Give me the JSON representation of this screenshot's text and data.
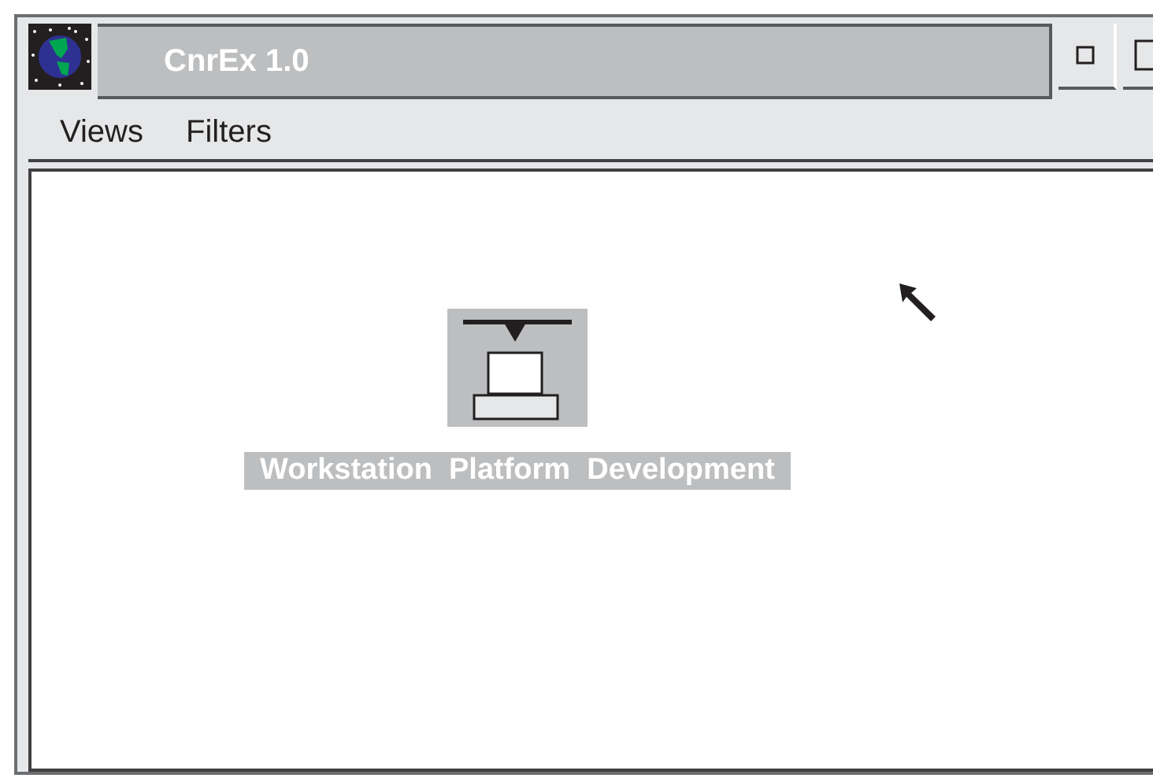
{
  "window": {
    "title": "CnrEx 1.0"
  },
  "menu": [
    "Views",
    "Filters"
  ],
  "nodes": [
    {
      "label": "Workstation  Platform  Development",
      "selected": true
    }
  ]
}
